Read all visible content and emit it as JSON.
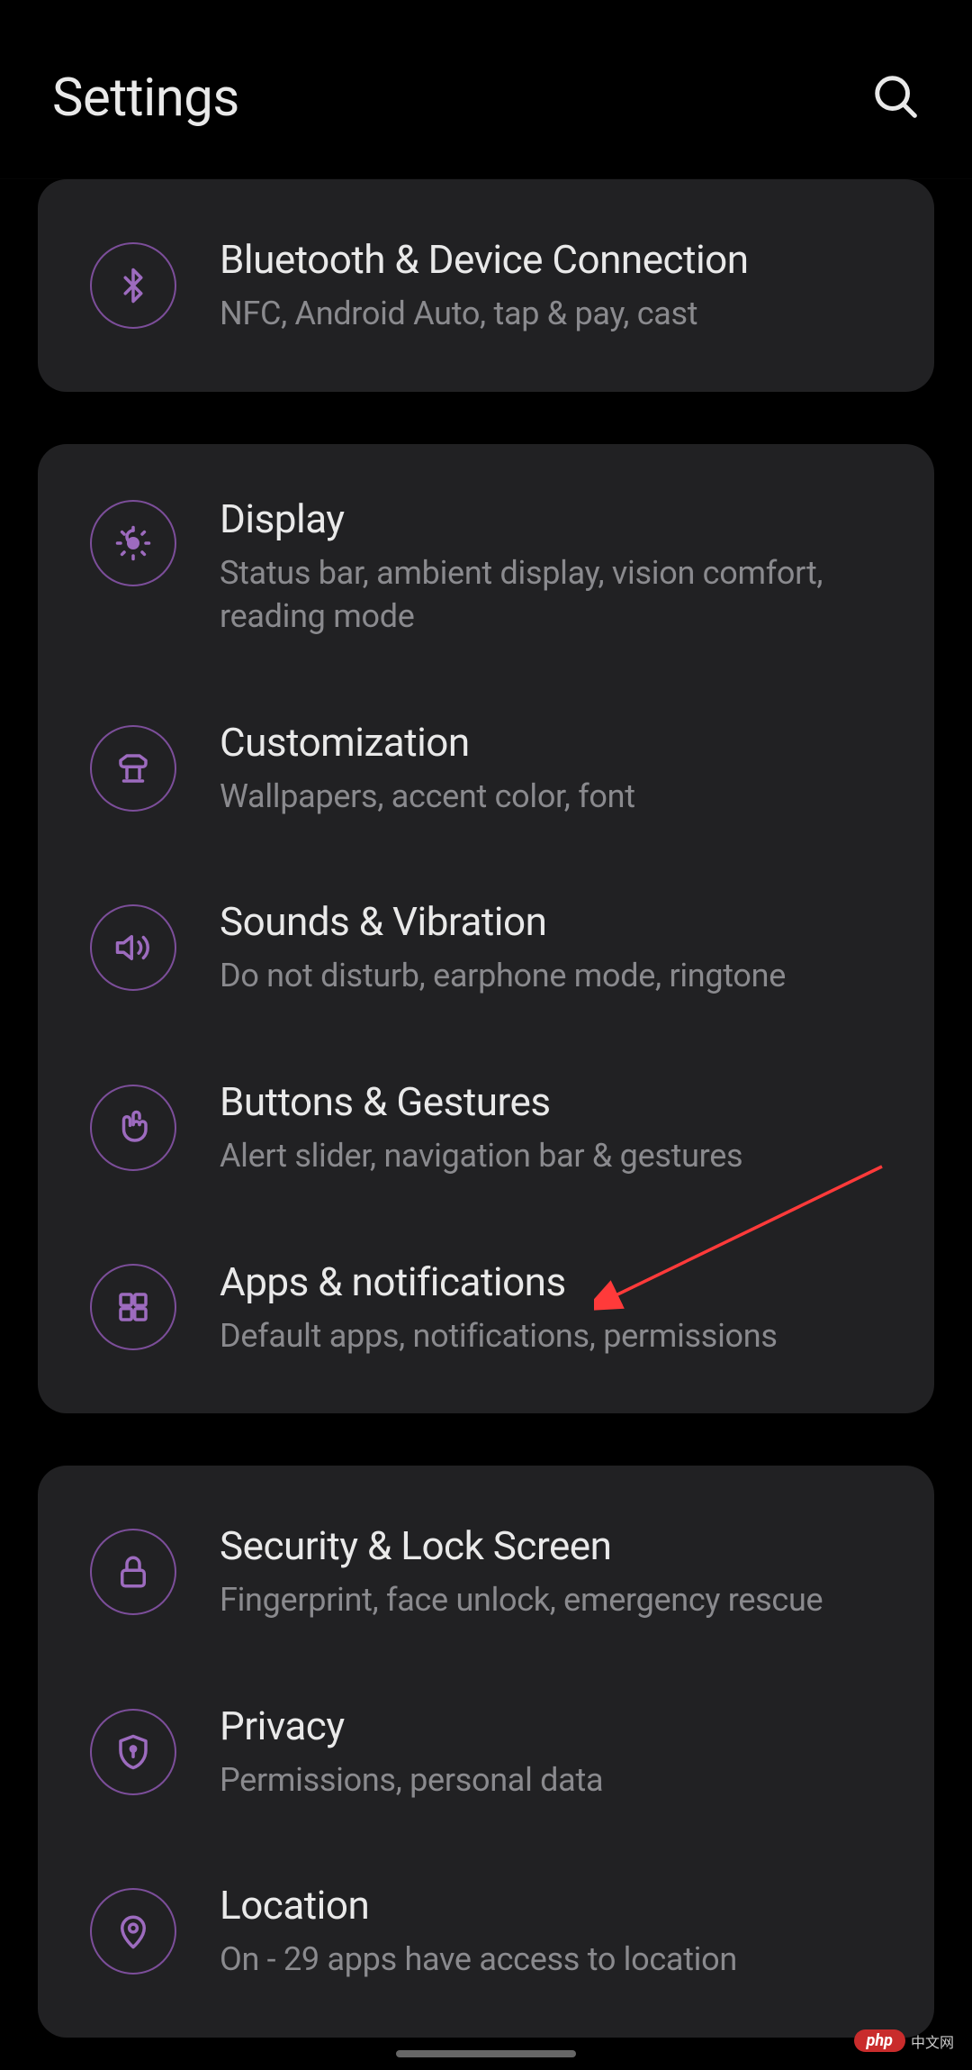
{
  "header": {
    "title": "Settings"
  },
  "groups": [
    {
      "items": [
        {
          "icon": "bluetooth",
          "title": "Bluetooth & Device Connection",
          "subtitle": "NFC, Android Auto, tap & pay, cast"
        }
      ]
    },
    {
      "items": [
        {
          "icon": "display",
          "title": "Display",
          "subtitle": "Status bar, ambient display, vision comfort, reading mode",
          "multiline": true
        },
        {
          "icon": "customization",
          "title": "Customization",
          "subtitle": "Wallpapers, accent color, font"
        },
        {
          "icon": "sound",
          "title": "Sounds & Vibration",
          "subtitle": "Do not disturb, earphone mode, ringtone"
        },
        {
          "icon": "gestures",
          "title": "Buttons & Gestures",
          "subtitle": "Alert slider, navigation bar & gestures"
        },
        {
          "icon": "apps",
          "title": "Apps & notifications",
          "subtitle": "Default apps, notifications, permissions"
        }
      ]
    },
    {
      "items": [
        {
          "icon": "lock",
          "title": "Security & Lock Screen",
          "subtitle": "Fingerprint, face unlock, emergency rescue"
        },
        {
          "icon": "privacy",
          "title": "Privacy",
          "subtitle": "Permissions, personal data"
        },
        {
          "icon": "location",
          "title": "Location",
          "subtitle": "On - 29 apps have access to location"
        }
      ]
    }
  ],
  "watermark": {
    "badge": "php",
    "text": "中文网"
  }
}
